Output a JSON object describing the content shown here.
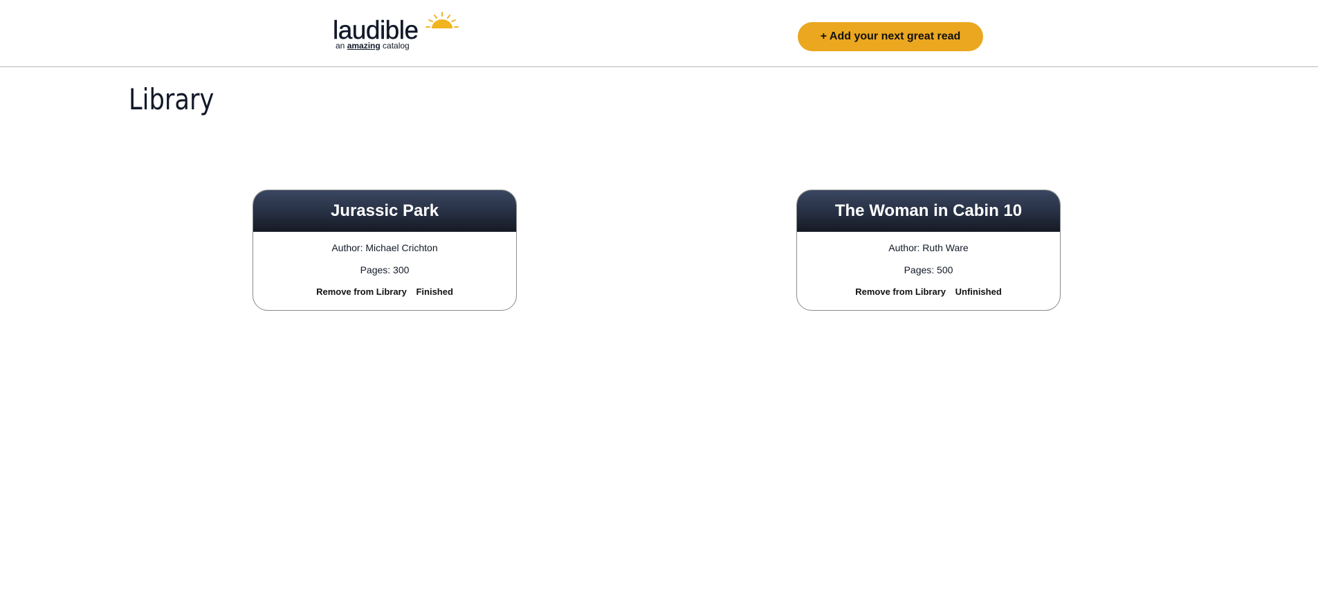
{
  "header": {
    "logo_word": "laudible",
    "logo_tag_prefix": "an ",
    "logo_tag_emphasis": "amazing",
    "logo_tag_suffix": " catalog",
    "logo_icon": "sun-icon",
    "add_button_label": "+ Add your next great read",
    "accent_color": "#eba71f"
  },
  "main": {
    "title": "Library",
    "books": [
      {
        "title": "Jurassic Park",
        "author": "Author: Michael Crichton",
        "pages": "Pages: 300",
        "remove_label": "Remove from Library",
        "status_label": "Finished"
      },
      {
        "title": "The Woman in Cabin 10",
        "author": "Author: Ruth Ware",
        "pages": "Pages: 500",
        "remove_label": "Remove from Library",
        "status_label": "Unfinished"
      }
    ]
  }
}
